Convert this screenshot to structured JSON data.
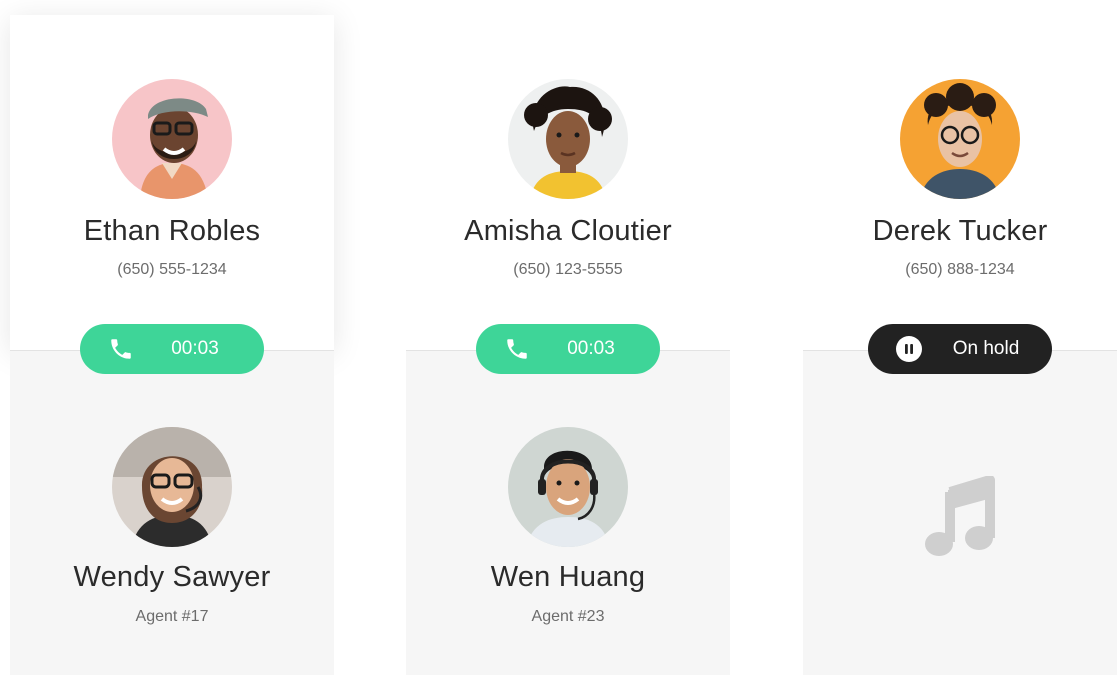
{
  "calls": [
    {
      "caller": {
        "name": "Ethan Robles",
        "phone": "(650) 555-1234",
        "avatar_bg": "#f7c5c8"
      },
      "status": {
        "type": "active",
        "label": "00:03",
        "icon": "phone-icon",
        "color": "#3ed598"
      },
      "agent": {
        "name": "Wendy Sawyer",
        "id_label": "Agent #17"
      }
    },
    {
      "caller": {
        "name": "Amisha Cloutier",
        "phone": "(650) 123-5555",
        "avatar_bg": "#eef0f0"
      },
      "status": {
        "type": "active",
        "label": "00:03",
        "icon": "phone-icon",
        "color": "#3ed598"
      },
      "agent": {
        "name": "Wen Huang",
        "id_label": "Agent #23"
      }
    },
    {
      "caller": {
        "name": "Derek Tucker",
        "phone": "(650) 888-1234",
        "avatar_bg": "#f5a233"
      },
      "status": {
        "type": "hold",
        "label": "On hold",
        "icon": "pause-icon",
        "color": "#222222"
      },
      "agent": {
        "placeholder_icon": "music-note-icon"
      }
    }
  ]
}
